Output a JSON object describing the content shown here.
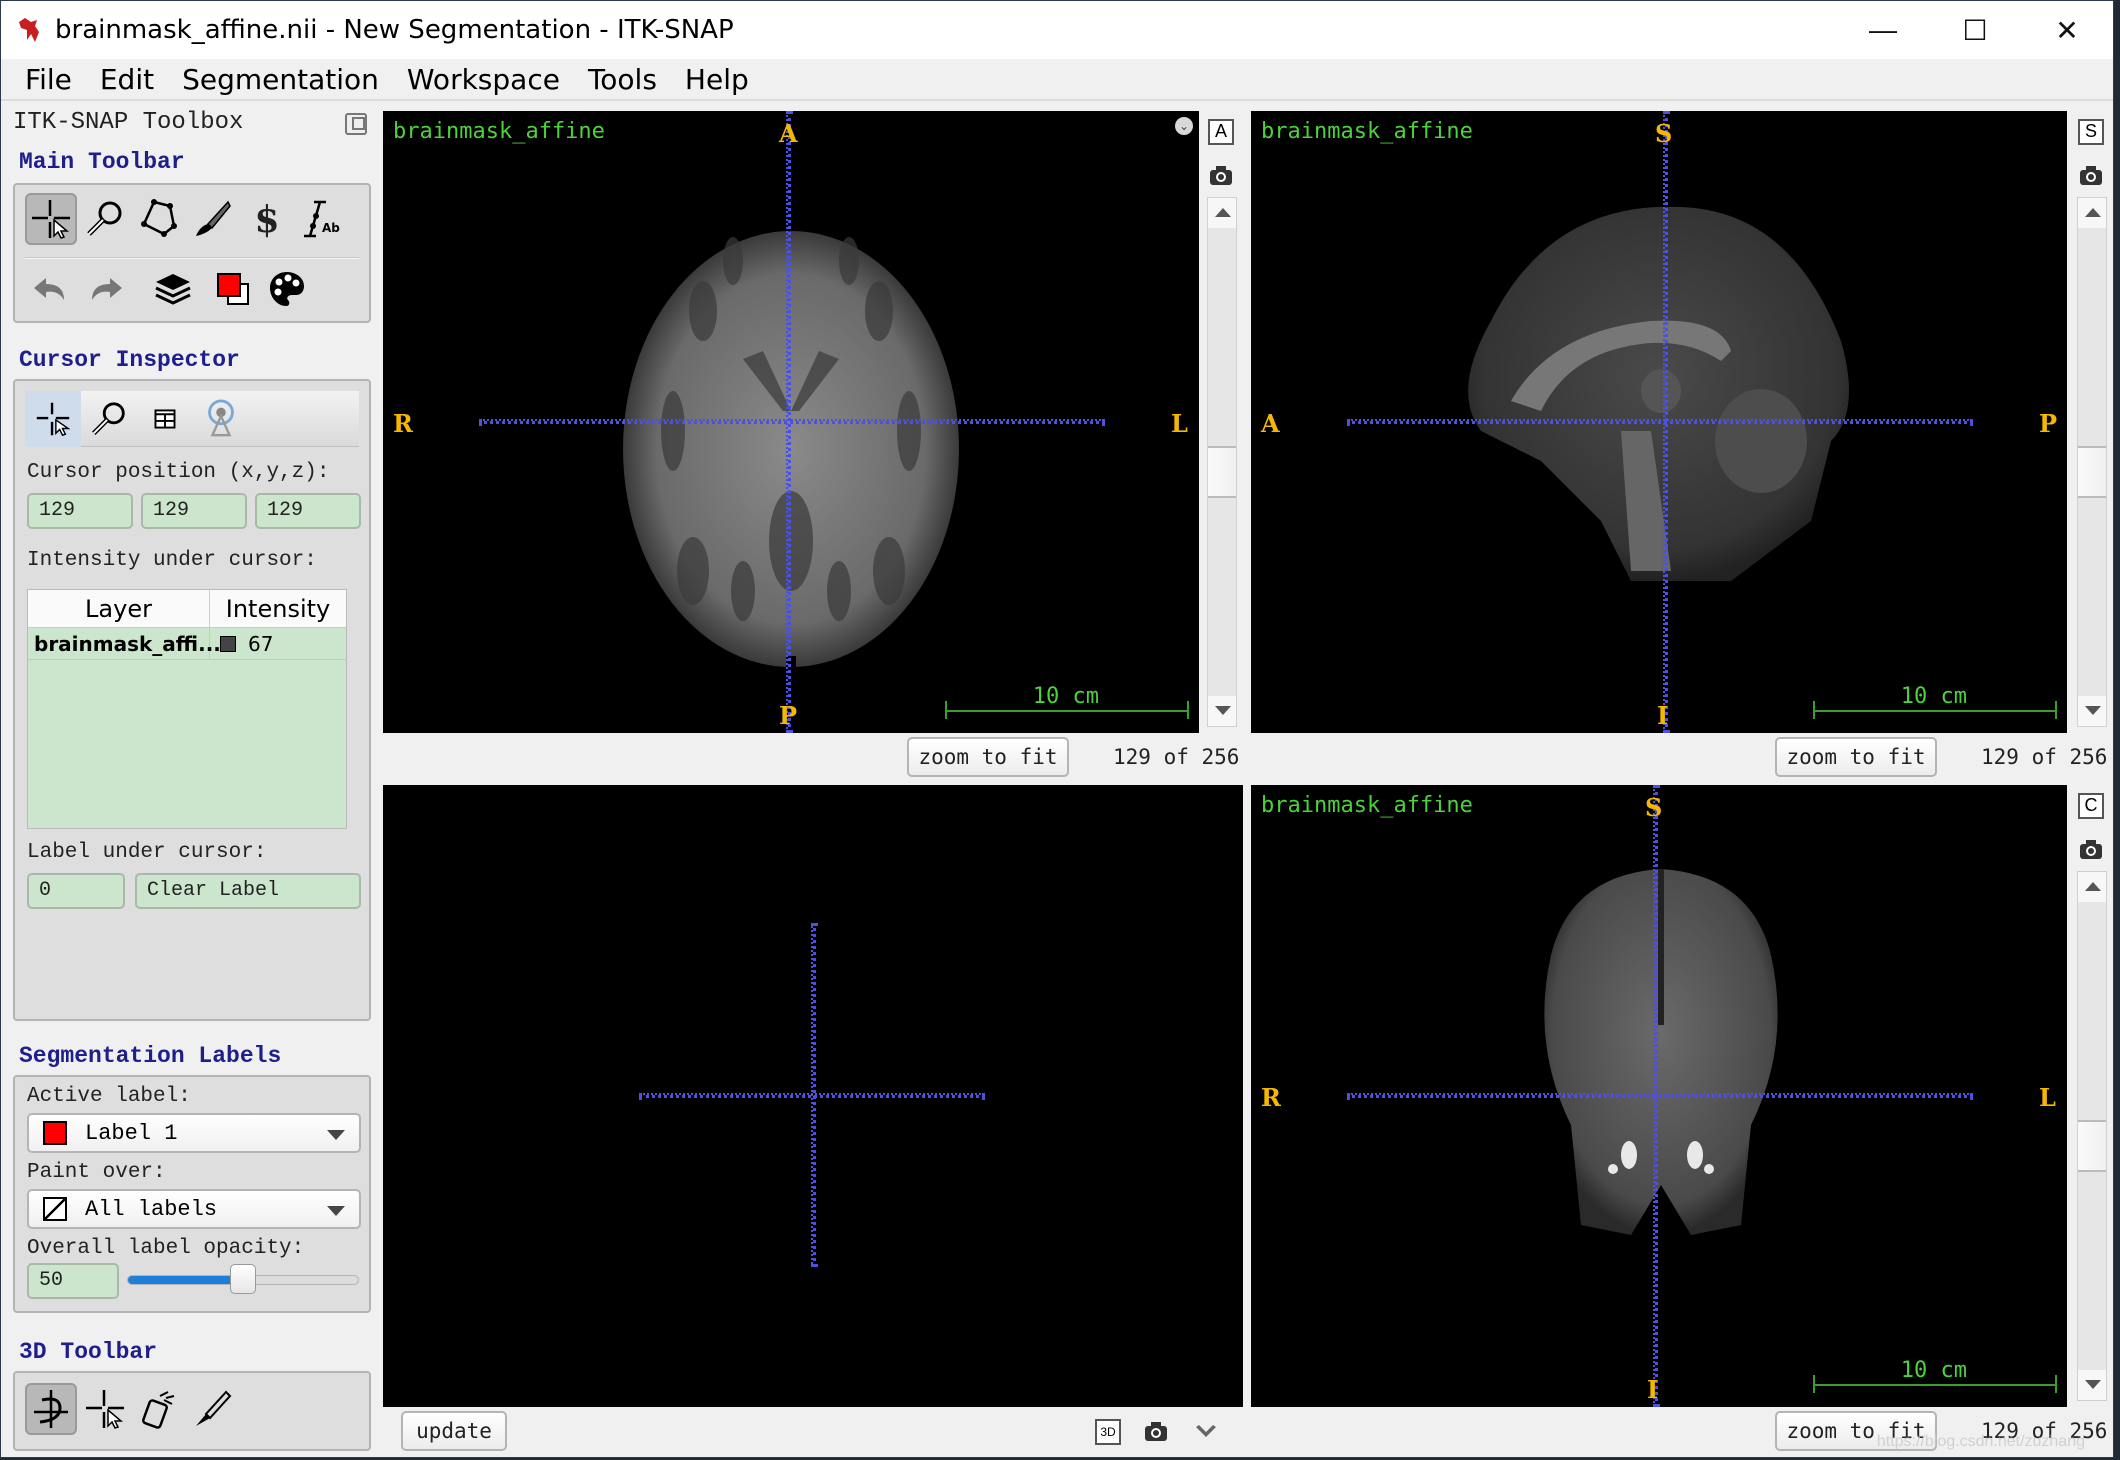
{
  "window": {
    "title": "brainmask_affine.nii - New Segmentation - ITK-SNAP",
    "controls": {
      "minimize": "—",
      "maximize": "☐",
      "close": "✕"
    }
  },
  "menu": [
    "File",
    "Edit",
    "Segmentation",
    "Workspace",
    "Tools",
    "Help"
  ],
  "toolbox": {
    "title": "ITK-SNAP Toolbox",
    "main_toolbar": {
      "title": "Main Toolbar",
      "tools": [
        "crosshair-mode",
        "zoom-pan-mode",
        "polygon-mode",
        "paintbrush-mode",
        "snake-mode",
        "ruler-annotation-mode"
      ],
      "active_tool": "crosshair-mode",
      "actions": [
        "undo",
        "redo",
        "layer-inspector",
        "label-editor",
        "color-map-editor"
      ]
    },
    "cursor_inspector": {
      "title": "Cursor Inspector",
      "tabs": [
        "cursor",
        "zoom",
        "layout",
        "synchronize"
      ],
      "cursor_position_label": "Cursor position (x,y,z):",
      "cursor_position": [
        "129",
        "129",
        "129"
      ],
      "intensity_label": "Intensity under cursor:",
      "table": {
        "headers": [
          "Layer",
          "Intensity"
        ],
        "rows": [
          {
            "layer": "brainmask_affi...",
            "intensity": "67",
            "swatch": "#444444"
          }
        ]
      },
      "label_under_cursor_label": "Label under cursor:",
      "label_id": "0",
      "label_name": "Clear Label"
    },
    "segmentation_labels": {
      "title": "Segmentation Labels",
      "active_label_caption": "Active label:",
      "active_label": "Label 1",
      "active_label_color": "#ff0000",
      "paint_over_caption": "Paint over:",
      "paint_over": "All labels",
      "opacity_caption": "Overall label opacity:",
      "opacity_value": "50",
      "opacity_fraction": 0.5
    },
    "toolbar_3d": {
      "title": "3D Toolbar",
      "tools": [
        "rotate-3d",
        "crosshair-3d",
        "spray-paint-3d",
        "scalpel-3d"
      ],
      "active_tool": "rotate-3d"
    }
  },
  "views": {
    "axial": {
      "layer_name": "brainmask_affine",
      "orient": {
        "top": "A",
        "bottom": "P",
        "left": "R",
        "right": "L"
      },
      "scale_label": "10 cm",
      "zoom_button": "zoom to fit",
      "slice_text": "129 of 256",
      "view_id": "A"
    },
    "sagittal": {
      "layer_name": "brainmask_affine",
      "orient": {
        "top": "S",
        "bottom": "I",
        "left": "A",
        "right": "P"
      },
      "scale_label": "10 cm",
      "zoom_button": "zoom to fit",
      "slice_text": "129 of 256",
      "view_id": "S"
    },
    "three_d": {
      "update_button": "update",
      "view_id": "3D"
    },
    "coronal": {
      "layer_name": "brainmask_affine",
      "orient": {
        "top": "S",
        "bottom": "I",
        "left": "R",
        "right": "L"
      },
      "scale_label": "10 cm",
      "zoom_button": "zoom to fit",
      "slice_text": "129 of 256",
      "view_id": "C"
    }
  },
  "watermark": "https://blog.csdn.net/zuzhang"
}
